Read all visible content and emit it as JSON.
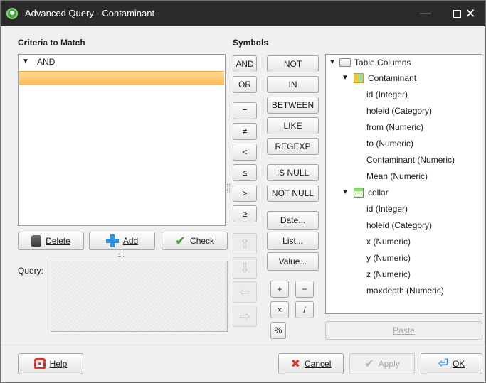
{
  "window": {
    "title": "Advanced Query - Contaminant",
    "minimize_glyph": "—",
    "close_glyph": "✕"
  },
  "criteria": {
    "label": "Criteria to Match",
    "rows": [
      {
        "text": "AND",
        "expanded": true,
        "selected": false
      },
      {
        "text": "",
        "expanded": false,
        "selected": true
      }
    ]
  },
  "criteria_buttons": {
    "delete_label": "Delete",
    "add_label": "Add",
    "check_label": "Check"
  },
  "query": {
    "label": "Query:",
    "value": ""
  },
  "symbols": {
    "label": "Symbols",
    "left_column": [
      "AND",
      "OR",
      "=",
      "≠",
      "<",
      "≤",
      ">",
      "≥"
    ],
    "right_column": [
      "NOT",
      "IN",
      "BETWEEN",
      "LIKE",
      "REGEXP",
      "IS NULL",
      "NOT NULL",
      "Date...",
      "List...",
      "Value..."
    ],
    "arithmetic": [
      "+",
      "−",
      "×",
      "/",
      "%"
    ],
    "arrows": [
      "up",
      "down",
      "left",
      "right"
    ]
  },
  "tree": {
    "root": "Table Columns",
    "tables": [
      {
        "name": "Contaminant",
        "color": "orange",
        "columns": [
          "id (Integer)",
          "holeid (Category)",
          "from (Numeric)",
          "to (Numeric)",
          "Contaminant (Numeric)",
          "Mean (Numeric)"
        ]
      },
      {
        "name": "collar",
        "color": "green",
        "columns": [
          "id (Integer)",
          "holeid (Category)",
          "x (Numeric)",
          "y (Numeric)",
          "z (Numeric)",
          "maxdepth (Numeric)"
        ]
      }
    ]
  },
  "paste_label": "Paste",
  "footer": {
    "help_label": "Help",
    "cancel_label": "Cancel",
    "apply_label": "Apply",
    "ok_label": "OK"
  },
  "icons": {
    "app": "app-icon",
    "delete": "trash-icon",
    "add": "plus-icon",
    "check": "check-icon",
    "help": "lifebuoy-icon",
    "cancel": "cancel-icon",
    "apply": "apply-icon",
    "ok": "ok-icon"
  },
  "colors": {
    "titlebar": "#2b2b2b",
    "selection": "#ffbc58",
    "accent": "#2c8de2"
  }
}
